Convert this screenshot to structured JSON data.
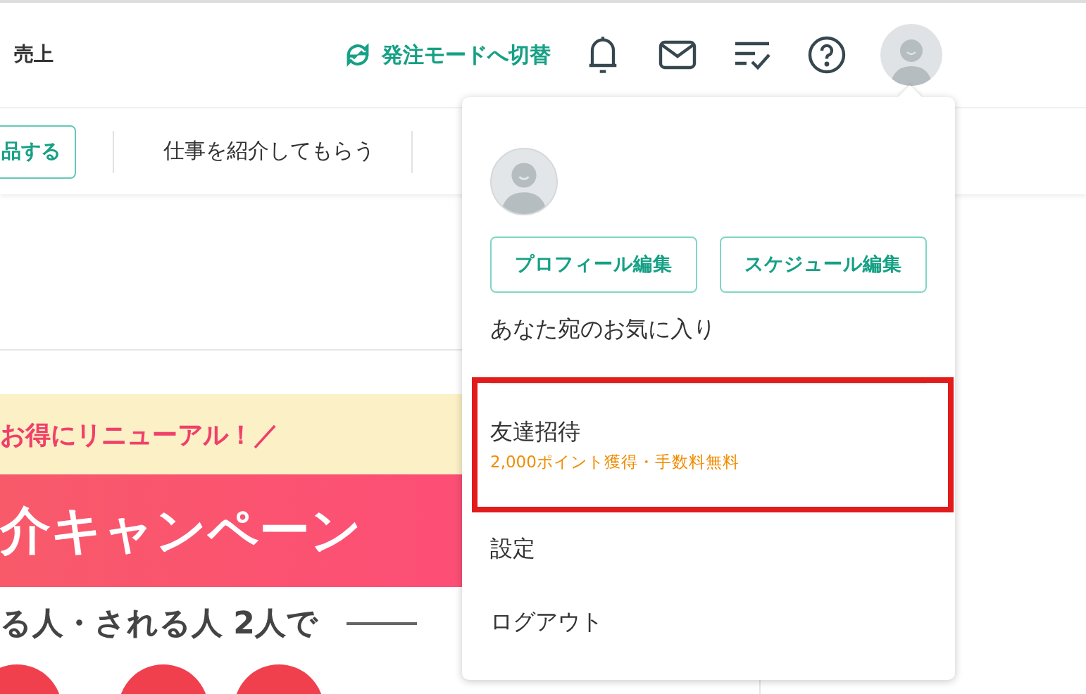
{
  "header": {
    "left_label": "売上",
    "mode_switch": "発注モードへ切替"
  },
  "subnav": {
    "button": "品する",
    "link": "仕事を紹介してもらう"
  },
  "banner": {
    "tagline": "お得にリニューアル！／",
    "title": "介キャンペーン",
    "subtitle": "る人・される人 2人で"
  },
  "account_menu": {
    "buttons": [
      "プロフィール編集",
      "スケジュール編集"
    ],
    "items": [
      {
        "kind": "plain",
        "label": "あなた宛のお気に入り",
        "highlighted": false
      },
      {
        "kind": "promo",
        "label": "友達招待",
        "note": "2,000ポイント獲得・手数料無料",
        "highlighted": true
      },
      {
        "kind": "plain",
        "label": "設定",
        "highlighted": false
      },
      {
        "kind": "plain",
        "label": "ログアウト",
        "highlighted": false
      }
    ]
  }
}
